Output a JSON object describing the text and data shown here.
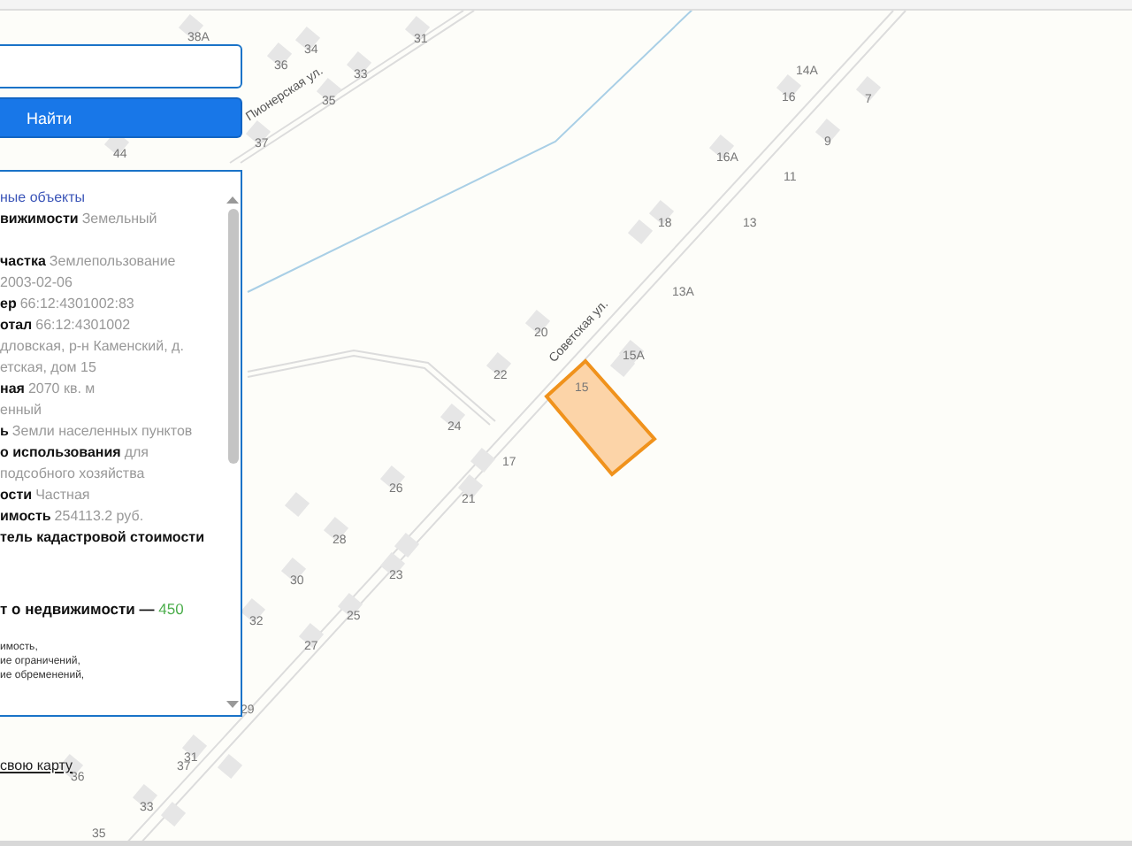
{
  "search": {
    "button": "Найти"
  },
  "panel": {
    "heading": "ные объекты",
    "lines": [
      {
        "label": "вижимости",
        "value": "Земельный"
      },
      {
        "label": "частка",
        "value": "Землепользование"
      },
      {
        "value": "2003-02-06"
      },
      {
        "label": "ер",
        "value": "66:12:4301002:83"
      },
      {
        "label": "отал",
        "value": "66:12:4301002"
      },
      {
        "value": "дловская, р-н Каменский, д."
      },
      {
        "value": "етская, дом 15"
      },
      {
        "label": "ная",
        "value": "2070 кв. м"
      },
      {
        "value": "енный"
      },
      {
        "label": "ь",
        "value": "Земли населенных пунктов"
      },
      {
        "label": "о использования",
        "value": "для"
      },
      {
        "value": "подсобного хозяйства"
      },
      {
        "label": "ости",
        "value": "Частная"
      },
      {
        "label": "имость",
        "value": "254113.2 руб."
      },
      {
        "label": "тель кадастровой стоимости"
      }
    ],
    "report": {
      "label": "т о недвижимости —",
      "count": "450"
    },
    "notes": [
      "имость,",
      "ие ограничений,",
      "ие обременений,"
    ]
  },
  "map_link": "свою карту",
  "map": {
    "streets": [
      "Пионерская ул.",
      "Советская ул."
    ],
    "house_numbers": [
      "38А",
      "36",
      "34",
      "31",
      "33",
      "35",
      "37",
      "44",
      "14А",
      "16",
      "7",
      "16А",
      "9",
      "11",
      "18",
      "13",
      "13А",
      "20",
      "22",
      "15А",
      "15",
      "24",
      "17",
      "26",
      "21",
      "28",
      "23",
      "30",
      "32",
      "25",
      "27",
      "29",
      "37",
      "31",
      "36",
      "33",
      "35"
    ]
  }
}
